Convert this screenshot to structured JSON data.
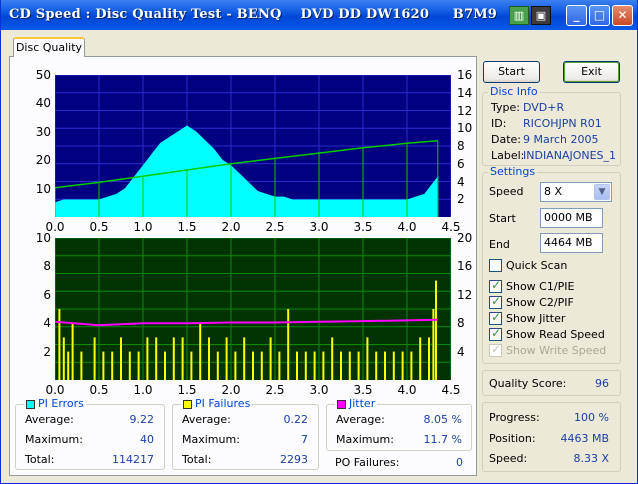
{
  "window": {
    "title": "CD Speed : Disc Quality Test - BENQ    DVD DD DW1620     B7M9",
    "icons": [
      "green-app-icon",
      "disk-icon"
    ],
    "controls": [
      "minimize-icon",
      "maximize-icon",
      "close-icon"
    ]
  },
  "tabs": [
    {
      "label": "Disc Quality",
      "active": true
    }
  ],
  "buttons": {
    "start": "Start",
    "exit": "Exit"
  },
  "disc_info": {
    "title": "Disc Info",
    "type_label": "Type:",
    "type": "DVD+R",
    "id_label": "ID:",
    "id": "RICOHJPN R01",
    "date_label": "Date:",
    "date": "9 March 2005",
    "label_label": "Label:",
    "label": "INDIANAJONES_1"
  },
  "settings": {
    "title": "Settings",
    "speed_label": "Speed",
    "speed": "8 X",
    "start_label": "Start",
    "start": "0000 MB",
    "end_label": "End",
    "end": "4464 MB",
    "quick_scan": {
      "label": "Quick Scan",
      "checked": false
    },
    "show_c1": {
      "label": "Show C1/PIE",
      "checked": true
    },
    "show_c2": {
      "label": "Show C2/PIF",
      "checked": true
    },
    "show_jitter": {
      "label": "Show Jitter",
      "checked": true
    },
    "show_read": {
      "label": "Show Read Speed",
      "checked": true
    },
    "show_write": {
      "label": "Show Write Speed",
      "checked": true,
      "disabled": true
    }
  },
  "quality": {
    "label": "Quality Score:",
    "value": "96"
  },
  "progress": {
    "progress_label": "Progress:",
    "progress": "100 %",
    "position_label": "Position:",
    "position": "4463 MB",
    "speed_label": "Speed:",
    "speed": "8.33 X"
  },
  "pi_errors": {
    "title": "PI Errors",
    "color": "#00ffff",
    "average_label": "Average:",
    "average": "9.22",
    "maximum_label": "Maximum:",
    "maximum": "40",
    "total_label": "Total:",
    "total": "114217"
  },
  "pi_failures": {
    "title": "PI Failures",
    "color": "#ffff00",
    "average_label": "Average:",
    "average": "0.22",
    "maximum_label": "Maximum:",
    "maximum": "7",
    "total_label": "Total:",
    "total": "2293"
  },
  "jitter": {
    "title": "Jitter",
    "color": "#ff00ff",
    "average_label": "Average:",
    "average": "8.05 %",
    "maximum_label": "Maximum:",
    "maximum": "11.7 %"
  },
  "po_failures": {
    "label": "PO Failures:",
    "value": "0"
  },
  "chart_data": [
    {
      "type": "area",
      "series": [
        {
          "name": "PI Errors",
          "color": "#00ffff",
          "x": [
            0.0,
            0.1,
            0.2,
            0.3,
            0.4,
            0.5,
            0.6,
            0.7,
            0.8,
            0.9,
            1.0,
            1.1,
            1.2,
            1.3,
            1.4,
            1.5,
            1.6,
            1.7,
            1.8,
            1.9,
            2.0,
            2.1,
            2.2,
            2.3,
            2.4,
            2.5,
            2.6,
            2.7,
            2.8,
            2.9,
            3.0,
            3.1,
            3.2,
            3.3,
            3.4,
            3.5,
            3.6,
            3.7,
            3.8,
            3.9,
            4.0,
            4.1,
            4.2,
            4.3,
            4.35
          ],
          "y": [
            5,
            6,
            6,
            6,
            6,
            6,
            7,
            8,
            10,
            14,
            18,
            22,
            26,
            28,
            30,
            32,
            30,
            27,
            24,
            20,
            18,
            15,
            12,
            9,
            8,
            7,
            7,
            6,
            6,
            6,
            6,
            6,
            6,
            6,
            6,
            6,
            6,
            6,
            6,
            6,
            6,
            7,
            8,
            12,
            14
          ]
        },
        {
          "name": "Read Speed",
          "color": "#00cc00",
          "x": [
            0.0,
            0.5,
            1.0,
            1.5,
            2.0,
            2.5,
            3.0,
            3.5,
            4.0,
            4.35
          ],
          "y": [
            3.3,
            3.9,
            4.6,
            5.3,
            6.0,
            6.6,
            7.2,
            7.8,
            8.3,
            8.6
          ]
        }
      ],
      "xlim": [
        0,
        4.5
      ],
      "ylim": [
        0,
        50
      ],
      "y2lim": [
        0,
        16
      ],
      "xticks": [
        "0.0",
        "0.5",
        "1.0",
        "1.5",
        "2.0",
        "2.5",
        "3.0",
        "3.5",
        "4.0",
        "4.5"
      ],
      "yticks": [
        "10",
        "20",
        "30",
        "40",
        "50"
      ],
      "y2ticks": [
        "2",
        "4",
        "6",
        "8",
        "10",
        "12",
        "14",
        "16"
      ],
      "grid": true
    },
    {
      "type": "bar",
      "series": [
        {
          "name": "PI Failures",
          "color": "#ffff00",
          "x": [
            0.05,
            0.1,
            0.15,
            0.2,
            0.3,
            0.45,
            0.55,
            0.65,
            0.75,
            0.85,
            0.95,
            1.05,
            1.15,
            1.25,
            1.35,
            1.45,
            1.55,
            1.65,
            1.75,
            1.85,
            1.95,
            2.05,
            2.15,
            2.25,
            2.35,
            2.45,
            2.55,
            2.65,
            2.75,
            2.85,
            2.95,
            3.05,
            3.15,
            3.25,
            3.35,
            3.45,
            3.55,
            3.65,
            3.75,
            3.85,
            3.95,
            4.05,
            4.15,
            4.25,
            4.3,
            4.33
          ],
          "y": [
            5,
            3,
            2,
            4,
            2,
            3,
            2,
            2,
            3,
            2,
            2,
            3,
            3,
            2,
            3,
            3,
            2,
            4,
            3,
            2,
            3,
            2,
            3,
            2,
            2,
            3,
            2,
            5,
            2,
            2,
            2,
            2,
            3,
            2,
            2,
            2,
            3,
            2,
            2,
            2,
            2,
            2,
            3,
            3,
            5,
            7
          ]
        },
        {
          "name": "Jitter",
          "color": "#ff00ff",
          "x": [
            0.0,
            0.5,
            1.0,
            1.5,
            2.0,
            2.5,
            3.0,
            3.5,
            4.0,
            4.35
          ],
          "y": [
            8.2,
            7.7,
            8.0,
            8.0,
            8.1,
            8.1,
            8.2,
            8.3,
            8.4,
            8.5
          ]
        }
      ],
      "xlim": [
        0,
        4.5
      ],
      "ylim": [
        0,
        10
      ],
      "y2lim": [
        0,
        20
      ],
      "xticks": [
        "0.0",
        "0.5",
        "1.0",
        "1.5",
        "2.0",
        "2.5",
        "3.0",
        "3.5",
        "4.0",
        "4.5"
      ],
      "yticks": [
        "2",
        "4",
        "6",
        "8",
        "10"
      ],
      "y2ticks": [
        "4",
        "8",
        "12",
        "16",
        "20"
      ],
      "grid": true
    }
  ]
}
